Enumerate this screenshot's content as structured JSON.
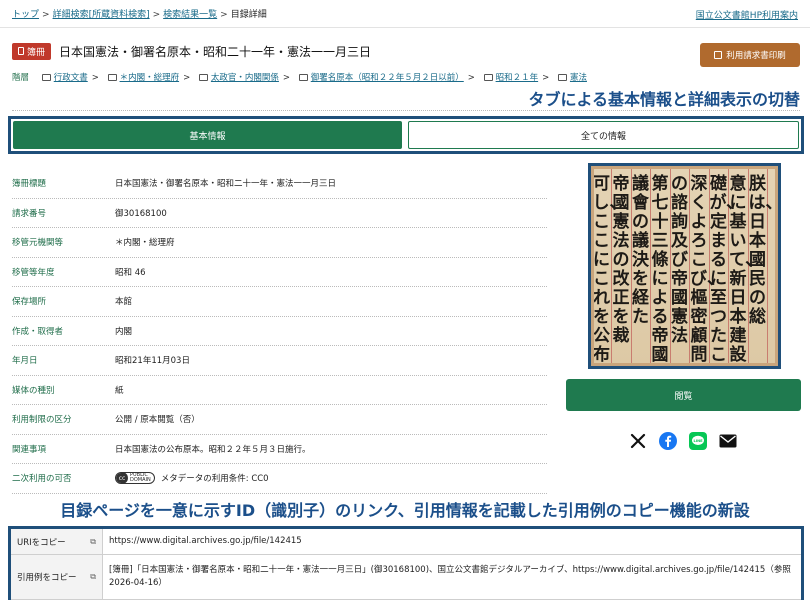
{
  "breadcrumb": {
    "items": [
      "トップ",
      "詳細検索[所蔵資料検索]",
      "検索結果一覧"
    ],
    "current": "目録詳細",
    "separator": ">"
  },
  "header_link": "国立公文書館HP利用案内",
  "record": {
    "badge": "簿冊",
    "title": "日本国憲法・御署名原本・昭和二十一年・憲法一一月三日"
  },
  "print_button": "利用請求書印刷",
  "hierarchy": {
    "label": "階層",
    "items": [
      "行政文書",
      "＊内閣・総理府",
      "太政官・内閣関係",
      "御署名原本（昭和２２年５月２日以前）",
      "昭和２１年",
      "憲法"
    ]
  },
  "annotation_tabs": "タブによる基本情報と詳細表示の切替",
  "tabs": {
    "basic": "基本情報",
    "all": "全ての情報"
  },
  "metadata": [
    {
      "label": "簿冊標題",
      "value": "日本国憲法・御署名原本・昭和二十一年・憲法一一月三日"
    },
    {
      "label": "請求番号",
      "value": "御30168100"
    },
    {
      "label": "移管元機関等",
      "value": "＊内閣・総理府"
    },
    {
      "label": "移管等年度",
      "value": "昭和 46"
    },
    {
      "label": "保存場所",
      "value": "本館"
    },
    {
      "label": "作成・取得者",
      "value": "内閣"
    },
    {
      "label": "年月日",
      "value": "昭和21年11月03日"
    },
    {
      "label": "媒体の種別",
      "value": "紙"
    },
    {
      "label": "利用制限の区分",
      "value": "公開 / 原本閲覧（否）"
    },
    {
      "label": "関連事項",
      "value": "日本国憲法の公布原本。昭和２２年５月３日施行。"
    },
    {
      "label": "二次利用の可否",
      "value": "メタデータの利用条件: CC0"
    }
  ],
  "cc0_badge": {
    "symbol": "cc",
    "line1": "PUBLIC",
    "line2": "DOMAIN"
  },
  "manuscript_columns": [
    "朕は、日本國民の総",
    "意に基いて、新日本建設の",
    "礎が、定まるに至つたことを、",
    "深くよろこび、樞密顧問",
    "の諮詢及び帝國憲法",
    "第七十三條による帝國",
    "議會の議決を経た",
    "帝國憲法の改正を裁",
    "可し、ここにこれを公布せしめる。"
  ],
  "view_button": "閲覧",
  "share_icons": [
    "x-icon",
    "facebook-icon",
    "line-icon",
    "mail-icon"
  ],
  "share": {
    "line_label": "LINE"
  },
  "annotation_cite": "目録ページを一意に示すID（識別子）のリンク、引用情報を記載した引用例のコピー機能の新設",
  "citation": {
    "uri_label": "URIをコピー",
    "uri_value": "https://www.digital.archives.go.jp/file/142415",
    "cite_label": "引用例をコピー",
    "cite_value": "[簿冊]「日本国憲法・御署名原本・昭和二十一年・憲法一一月三日」(御30168100)、国立公文書館デジタルアーカイブ、https://www.digital.archives.go.jp/file/142415（参照 2026-04-16）"
  },
  "colors": {
    "green": "#1f7a4f",
    "navy_frame": "#1f4f7a",
    "annotation": "#1b4f8a",
    "badge_red": "#c0392b",
    "print_brown": "#b06a2e"
  }
}
